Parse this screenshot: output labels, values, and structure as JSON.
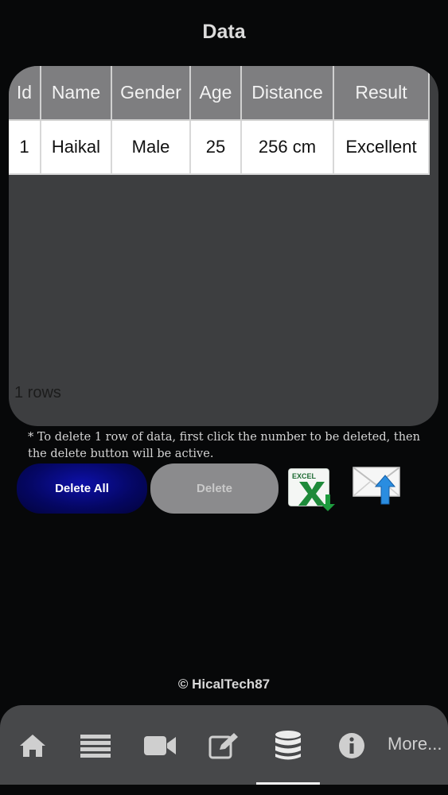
{
  "header": {
    "title": "Data"
  },
  "table": {
    "columns": [
      "Id",
      "Name",
      "Gender",
      "Age",
      "Distance",
      "Result"
    ],
    "rows": [
      [
        "1",
        "Haikal",
        "Male",
        "25",
        "256 cm",
        "Excellent"
      ]
    ],
    "row_count_label": "1 rows"
  },
  "note": "* To delete 1 row of data, first click the number to be deleted, then the delete button will be active.",
  "buttons": {
    "delete_all": "Delete All",
    "delete": "Delete",
    "excel_icon": "excel-export-icon",
    "email_icon": "email-upload-icon",
    "excel_icon_text": "EXCEL"
  },
  "footer": {
    "copyright": "© HicalTech87"
  },
  "nav": {
    "items": [
      "home-icon",
      "list-icon",
      "video-icon",
      "edit-icon",
      "database-icon",
      "info-icon"
    ],
    "more_label": "More...",
    "active": "database-icon"
  },
  "colors": {
    "background": "#070809",
    "card": "#3d3e40",
    "header_cell": "#7e7e80",
    "delete_all": "#050766",
    "delete_disabled": "#8b8b8d",
    "nav": "#47484a",
    "excel_green": "#1e8a3a",
    "mail_arrow": "#2a8de0"
  }
}
